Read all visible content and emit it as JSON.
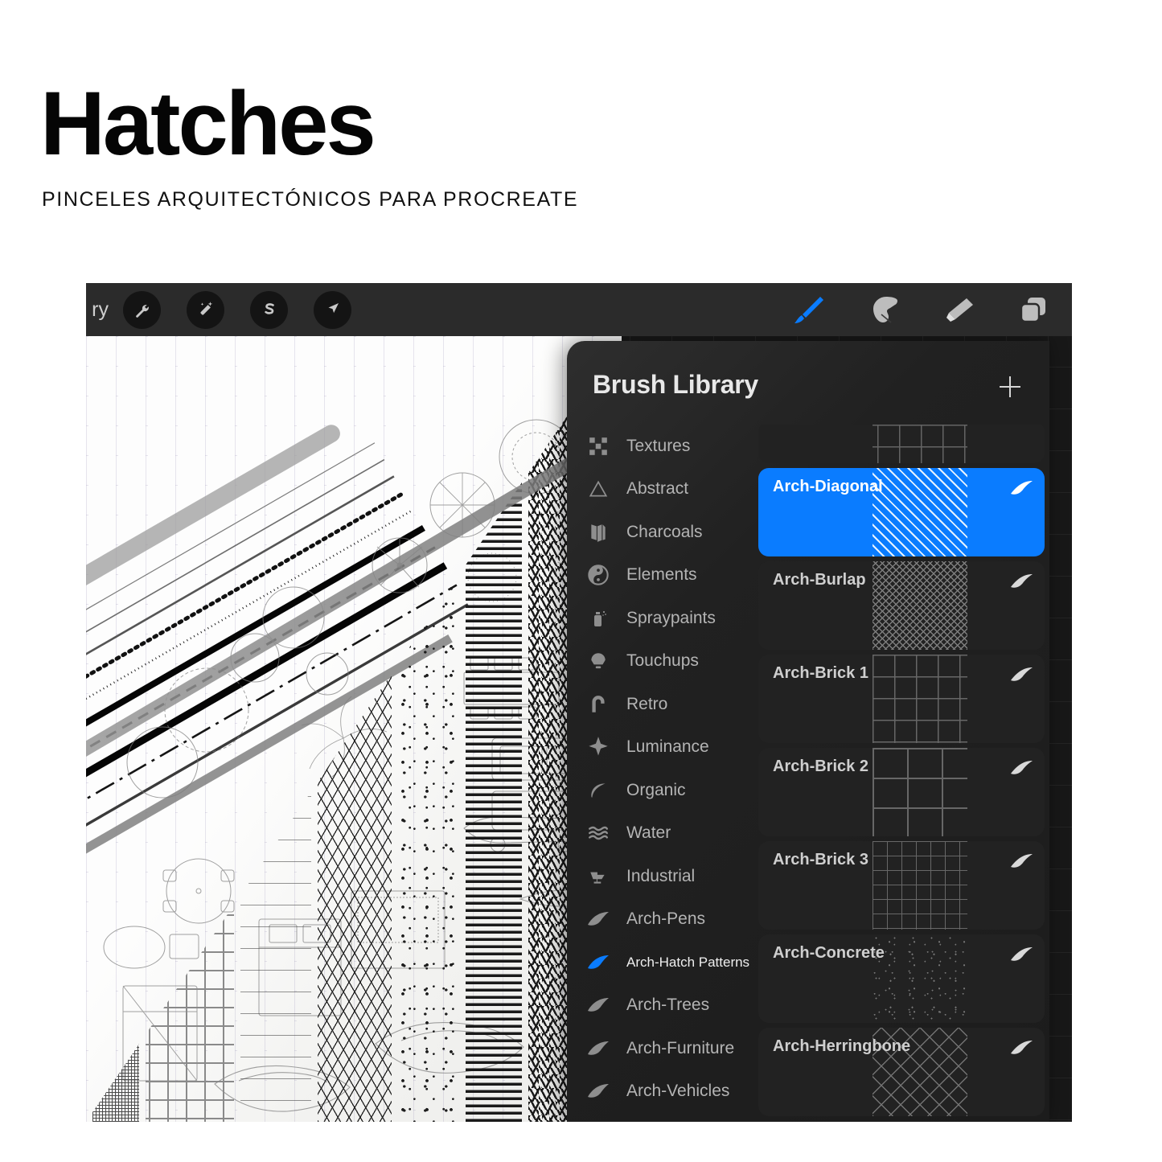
{
  "poster": {
    "title": "Hatches",
    "subtitle": "PINCELES ARQUITECTÓNICOS PARA PROCREATE"
  },
  "theme": {
    "accent": "#0A7CFF",
    "panel_bg": "#1F1F1F",
    "toolbar_bg": "#2B2B2B",
    "row_bg": "#222222",
    "text_primary": "#E8E8E8",
    "text_secondary": "#B4B4B4",
    "canvas_paper": "#F7F7F5"
  },
  "toolbar": {
    "left": [
      {
        "name": "gallery-button",
        "label": "ry"
      },
      {
        "name": "actions-wrench-icon",
        "label": "Actions"
      },
      {
        "name": "adjustments-wand-icon",
        "label": "Adjustments"
      },
      {
        "name": "selection-icon",
        "label": "Selection"
      },
      {
        "name": "transform-arrow-icon",
        "label": "Transform"
      }
    ],
    "right": [
      {
        "name": "paintbrush-icon",
        "label": "Paint",
        "active": true
      },
      {
        "name": "smudge-icon",
        "label": "Smudge",
        "active": false
      },
      {
        "name": "eraser-icon",
        "label": "Erase",
        "active": false
      },
      {
        "name": "layers-icon",
        "label": "Layers",
        "active": false
      }
    ]
  },
  "panel": {
    "title": "Brush Library",
    "add_label": "+",
    "categories": [
      {
        "label": "Textures",
        "icon": "checker-icon",
        "active": false
      },
      {
        "label": "Abstract",
        "icon": "triangle-icon",
        "active": false
      },
      {
        "label": "Charcoals",
        "icon": "charcoal-icon",
        "active": false
      },
      {
        "label": "Elements",
        "icon": "yinyang-icon",
        "active": false
      },
      {
        "label": "Spraypaints",
        "icon": "spraycan-icon",
        "active": false
      },
      {
        "label": "Touchups",
        "icon": "touchup-icon",
        "active": false
      },
      {
        "label": "Retro",
        "icon": "retro-icon",
        "active": false
      },
      {
        "label": "Luminance",
        "icon": "sparkle-icon",
        "active": false
      },
      {
        "label": "Organic",
        "icon": "leaf-icon",
        "active": false
      },
      {
        "label": "Water",
        "icon": "waves-icon",
        "active": false
      },
      {
        "label": "Industrial",
        "icon": "anvil-icon",
        "active": false
      },
      {
        "label": "Arch-Pens",
        "icon": "brush-icon",
        "active": false
      },
      {
        "label": "Arch-Hatch Patterns",
        "icon": "brush-icon",
        "active": true
      },
      {
        "label": "Arch-Trees",
        "icon": "brush-icon",
        "active": false
      },
      {
        "label": "Arch-Furniture",
        "icon": "brush-icon",
        "active": false
      },
      {
        "label": "Arch-Vehicles",
        "icon": "brush-icon",
        "active": false
      }
    ],
    "brushes": [
      {
        "label": "",
        "pattern": "grid",
        "selected": false,
        "partial": true
      },
      {
        "label": "Arch-Diagonal",
        "pattern": "diagonal",
        "selected": true,
        "partial": false
      },
      {
        "label": "Arch-Burlap",
        "pattern": "burlap",
        "selected": false,
        "partial": false
      },
      {
        "label": "Arch-Brick 1",
        "pattern": "brick1",
        "selected": false,
        "partial": false
      },
      {
        "label": "Arch-Brick 2",
        "pattern": "brick2",
        "selected": false,
        "partial": false
      },
      {
        "label": "Arch-Brick 3",
        "pattern": "brick3",
        "selected": false,
        "partial": false
      },
      {
        "label": "Arch-Concrete",
        "pattern": "concrete",
        "selected": false,
        "partial": false
      },
      {
        "label": "Arch-Herringbone",
        "pattern": "herring",
        "selected": false,
        "partial": false
      }
    ]
  },
  "canvas": {
    "description": "Architectural brush sampler artwork: diagonal pen strokes, plan-view trees, furniture and vehicle symbols, and columns of hatch pattern fills on dot-grid paper"
  }
}
